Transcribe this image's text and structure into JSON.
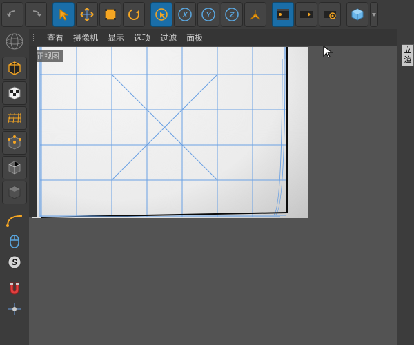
{
  "top": {
    "undo": "undo",
    "redo": "redo",
    "tools": [
      "select-arrow",
      "move",
      "scale",
      "rotate",
      "live-select",
      "axis-x",
      "axis-y",
      "axis-z",
      "coord",
      "render-frame",
      "render-range",
      "render-settings",
      "display-cube",
      "drop"
    ]
  },
  "menubar": {
    "items": [
      "查看",
      "摄像机",
      "显示",
      "选项",
      "过滤",
      "面板"
    ]
  },
  "viewlabel": "正视图",
  "leftbar": [
    "globe",
    "cube-sel",
    "poly-sel",
    "floor",
    "cube-point",
    "cube-edge",
    "cube-solid",
    "spacer",
    "bezier",
    "cursor-tool",
    "letter-s",
    "spacer",
    "snap-magnet",
    "origin"
  ],
  "rightmenu": [
    "立",
    "渲"
  ]
}
